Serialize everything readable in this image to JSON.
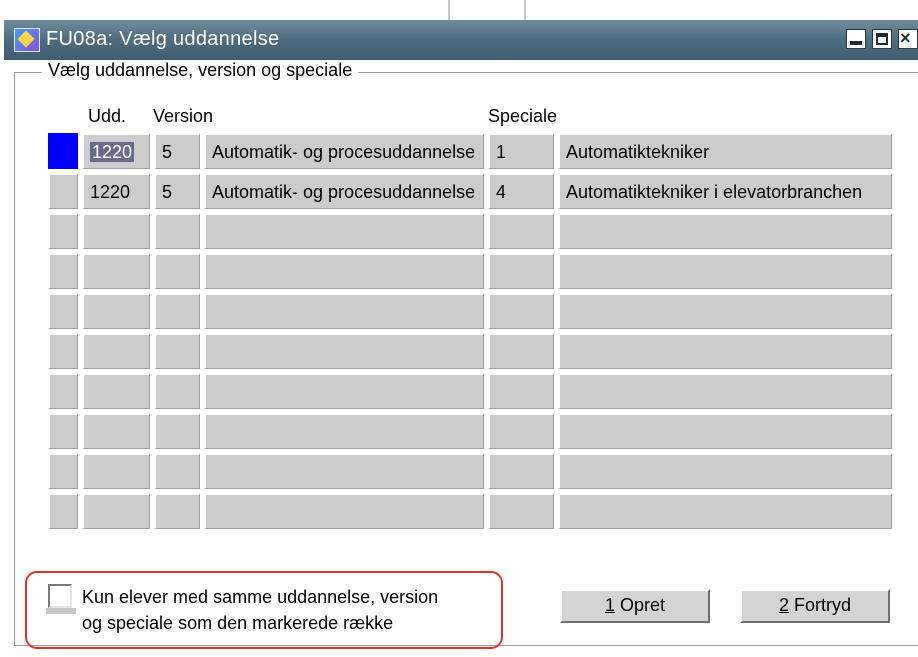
{
  "window": {
    "title": "FU08a: Vælg uddannelse",
    "group_title": "Vælg uddannelse, version og speciale"
  },
  "columns": {
    "udd": "Udd.",
    "version": "Version",
    "speciale": "Speciale"
  },
  "rows": [
    {
      "udd": "1220",
      "version": "5",
      "name": "Automatik- og procesuddannelse",
      "speciale": "1",
      "speciale_name": "Automatiktekniker",
      "selected": true
    },
    {
      "udd": "1220",
      "version": "5",
      "name": "Automatik- og procesuddannelse",
      "speciale": "4",
      "speciale_name": "Automatiktekniker i elevatorbranchen",
      "selected": false
    },
    {
      "udd": "",
      "version": "",
      "name": "",
      "speciale": "",
      "speciale_name": "",
      "selected": false
    },
    {
      "udd": "",
      "version": "",
      "name": "",
      "speciale": "",
      "speciale_name": "",
      "selected": false
    },
    {
      "udd": "",
      "version": "",
      "name": "",
      "speciale": "",
      "speciale_name": "",
      "selected": false
    },
    {
      "udd": "",
      "version": "",
      "name": "",
      "speciale": "",
      "speciale_name": "",
      "selected": false
    },
    {
      "udd": "",
      "version": "",
      "name": "",
      "speciale": "",
      "speciale_name": "",
      "selected": false
    },
    {
      "udd": "",
      "version": "",
      "name": "",
      "speciale": "",
      "speciale_name": "",
      "selected": false
    },
    {
      "udd": "",
      "version": "",
      "name": "",
      "speciale": "",
      "speciale_name": "",
      "selected": false
    },
    {
      "udd": "",
      "version": "",
      "name": "",
      "speciale": "",
      "speciale_name": "",
      "selected": false
    }
  ],
  "filter": {
    "line1": "Kun elever med samme uddannelse, version",
    "line2": "og speciale som den markerede række",
    "checked": false
  },
  "buttons": {
    "opret_key": "1",
    "opret_label": " Opret",
    "fortryd_key": "2",
    "fortryd_label": " Fortryd"
  },
  "colors": {
    "titlebar": "#4e6c7e",
    "cell": "#cccccc",
    "row_indicator": "#0000ff",
    "highlight": "#e0322c"
  }
}
